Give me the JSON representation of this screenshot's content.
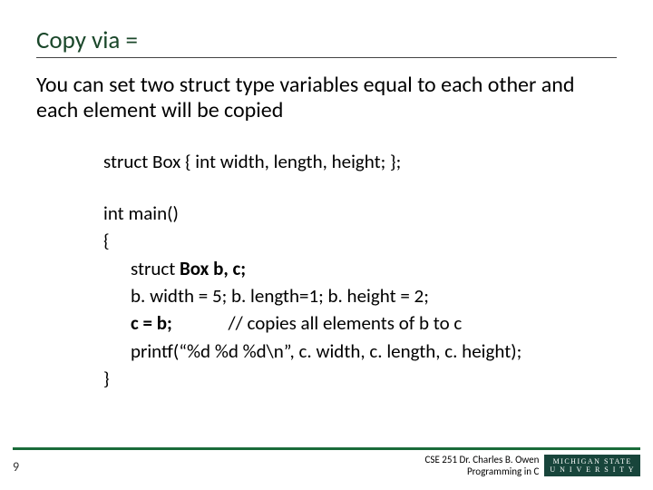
{
  "title": "Copy via =",
  "subtitle": "You can set two struct type variables equal to each other and each element will be copied",
  "code": {
    "decl": "struct Box { int width, length, height; };",
    "main": "int main()",
    "brace_open": "{",
    "line1_a": "struct ",
    "line1_b": "Box b, c;",
    "line2": "b. width = 5; b. length=1; b. height = 2;",
    "line3_a": "c = b;",
    "line3_b": "// copies all elements of b to c",
    "line4": "printf(“%d %d %d\\n”, c. width, c. length, c. height);",
    "brace_close": "}"
  },
  "footer": {
    "page": "9",
    "credit1": "CSE 251 Dr. Charles B. Owen",
    "credit2": "Programming in C",
    "logo_top": "MICHIGAN STATE",
    "logo_bot": "U N I V E R S I T Y"
  }
}
